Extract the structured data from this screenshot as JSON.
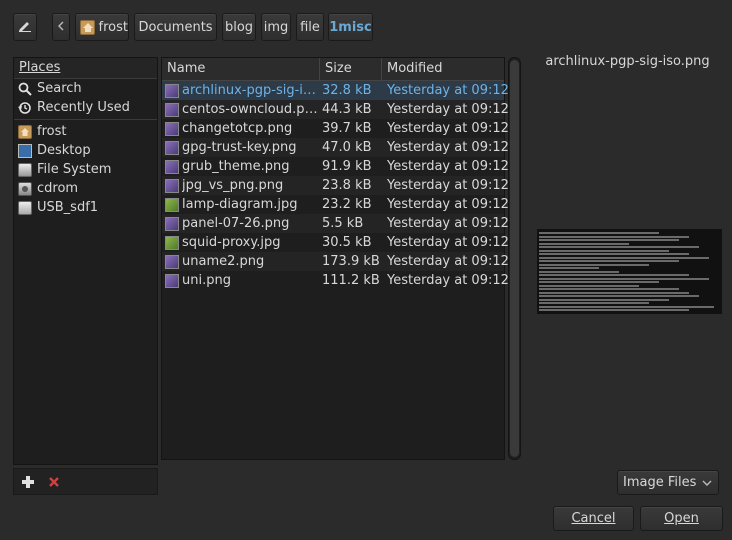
{
  "breadcrumb": {
    "items": [
      "frost",
      "Documents",
      "blog",
      "img",
      "file",
      "1misc"
    ],
    "active_index": 5
  },
  "places": {
    "header": "Places",
    "items": [
      {
        "label": "Search",
        "icon": "search-icon"
      },
      {
        "label": "Recently Used",
        "icon": "recent-icon"
      },
      {
        "label": "frost",
        "icon": "home-folder-icon"
      },
      {
        "label": "Desktop",
        "icon": "desktop-icon"
      },
      {
        "label": "File System",
        "icon": "harddisk-icon"
      },
      {
        "label": "cdrom",
        "icon": "cdrom-icon"
      },
      {
        "label": "USB_sdf1",
        "icon": "usb-drive-icon"
      }
    ]
  },
  "files": {
    "columns": {
      "name": "Name",
      "size": "Size",
      "modified": "Modified"
    },
    "rows": [
      {
        "name": "archlinux-pgp-sig-iso.png",
        "name_display": "archlinux-pgp-sig-is...",
        "size": "32.8 kB",
        "modified": "Yesterday at 09:12",
        "icon": "image-file-icon",
        "selected": true
      },
      {
        "name": "centos-owncloud.png",
        "size": "44.3 kB",
        "modified": "Yesterday at 09:12",
        "icon": "image-file-icon"
      },
      {
        "name": "changetotcp.png",
        "size": "39.7 kB",
        "modified": "Yesterday at 09:12",
        "icon": "image-file-icon"
      },
      {
        "name": "gpg-trust-key.png",
        "size": "47.0 kB",
        "modified": "Yesterday at 09:12",
        "icon": "image-file-icon"
      },
      {
        "name": "grub_theme.png",
        "size": "91.9 kB",
        "modified": "Yesterday at 09:12",
        "icon": "image-file-icon"
      },
      {
        "name": "jpg_vs_png.png",
        "size": "23.8 kB",
        "modified": "Yesterday at 09:12",
        "icon": "image-file-icon"
      },
      {
        "name": "lamp-diagram.jpg",
        "size": "23.2 kB",
        "modified": "Yesterday at 09:12",
        "icon": "image-file-icon"
      },
      {
        "name": "panel-07-26.png",
        "size": "5.5 kB",
        "modified": "Yesterday at 09:12",
        "icon": "image-file-icon"
      },
      {
        "name": "squid-proxy.jpg",
        "size": "30.5 kB",
        "modified": "Yesterday at 09:12",
        "icon": "image-file-icon"
      },
      {
        "name": "uname2.png",
        "size": "173.9 kB",
        "modified": "Yesterday at 09:12",
        "icon": "image-file-icon"
      },
      {
        "name": "uni.png",
        "size": "111.2 kB",
        "modified": "Yesterday at 09:12",
        "icon": "image-file-icon"
      }
    ]
  },
  "preview": {
    "filename": "archlinux-pgp-sig-iso.png"
  },
  "filter": {
    "selected": "Image Files"
  },
  "actions": {
    "cancel": "Cancel",
    "open": "Open"
  },
  "colors": {
    "accent": "#6fb3e6",
    "background": "#2b2b2b",
    "panel": "#1e1e1e"
  }
}
